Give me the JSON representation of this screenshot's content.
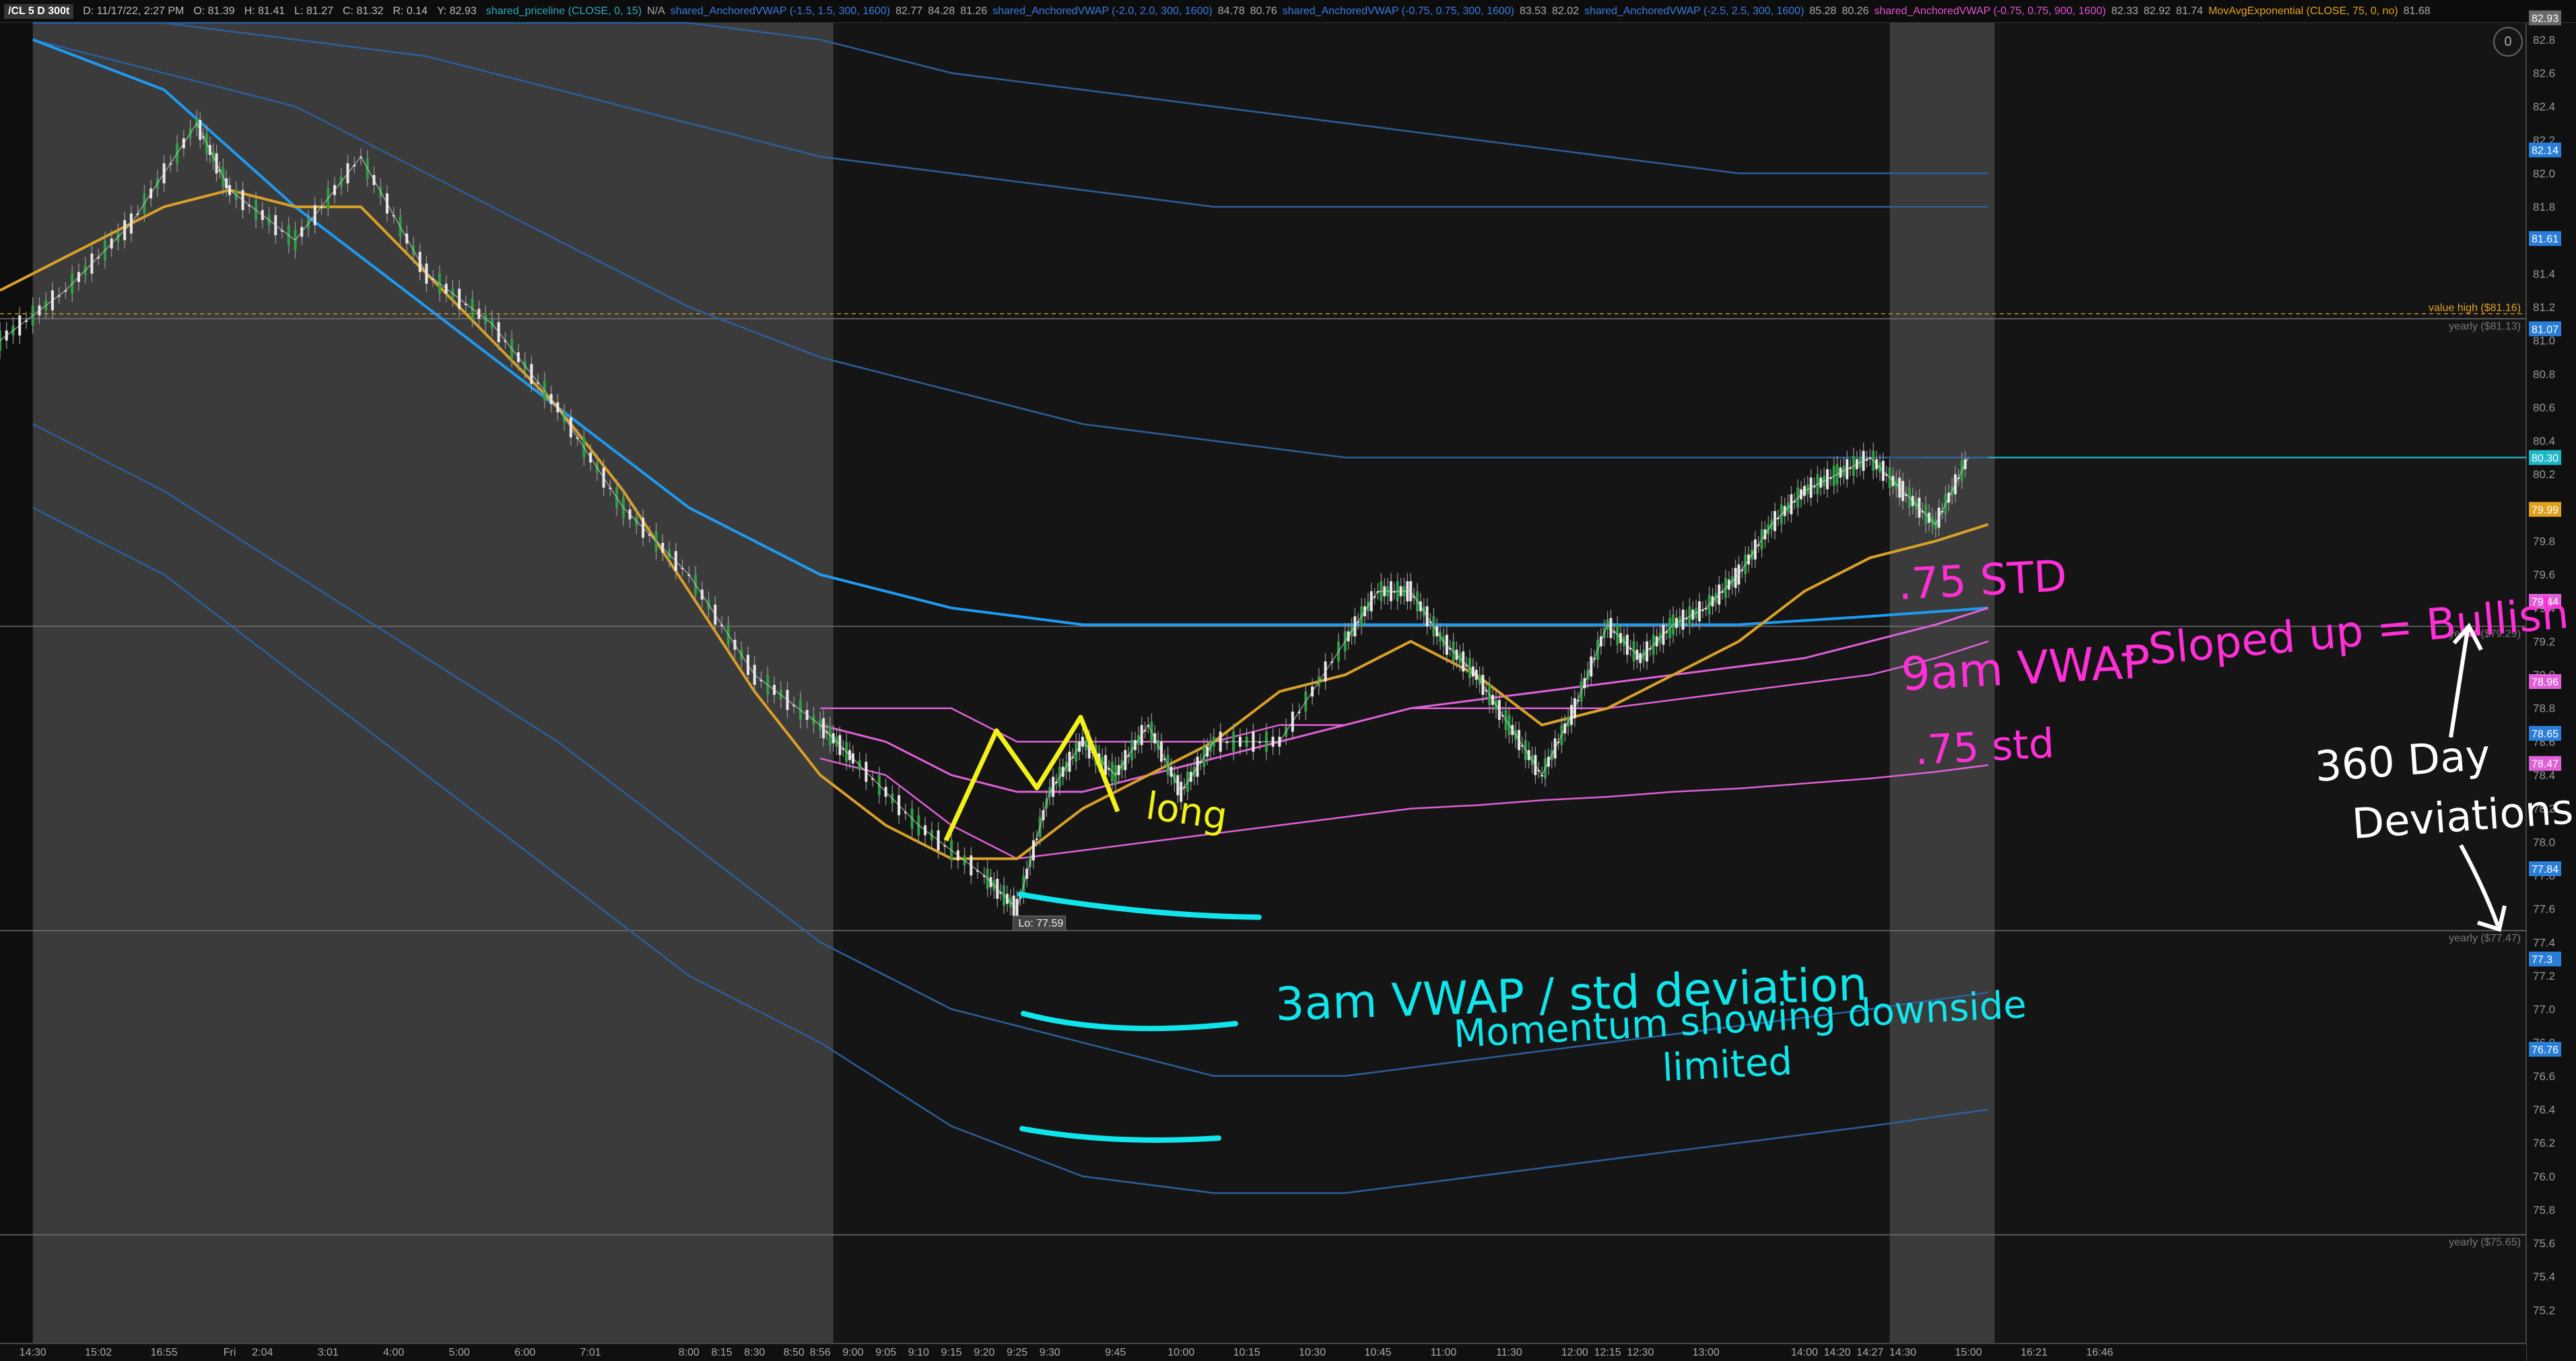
{
  "header": {
    "symbol": "/CL 5 D 300t",
    "date": "D: 11/17/22, 2:27 PM",
    "open": "O: 81.39",
    "high": "H: 81.41",
    "low": "L: 81.27",
    "close": "C: 81.32",
    "range": "R: 0.14",
    "last": "Y: 82.93",
    "studies": [
      {
        "label": "shared_priceline (CLOSE, 0, 15)",
        "values": [
          "N/A"
        ],
        "color": "#2aa8b8"
      },
      {
        "label": "shared_AnchoredVWAP (-1.5, 1.5, 300, 1600)",
        "values": [
          "82.77",
          "84.28",
          "81.26"
        ],
        "color": "#3a7be0"
      },
      {
        "label": "shared_AnchoredVWAP (-2.0, 2.0, 300, 1600)",
        "values": [
          "84.78",
          "80.76"
        ],
        "color": "#3a7be0"
      },
      {
        "label": "shared_AnchoredVWAP (-0.75, 0.75, 300, 1600)",
        "values": [
          "83.53",
          "82.02"
        ],
        "color": "#3a7be0"
      },
      {
        "label": "shared_AnchoredVWAP (-2.5, 2.5, 300, 1600)",
        "values": [
          "85.28",
          "80.26"
        ],
        "color": "#3a7be0"
      },
      {
        "label": "shared_AnchoredVWAP (-0.75, 0.75, 900, 1600)",
        "values": [
          "82.33",
          "82.92",
          "81.74"
        ],
        "color": "#e050d0"
      },
      {
        "label": "MovAvgExponential (CLOSE, 75, 0, no)",
        "values": [
          "81.68"
        ],
        "color": "#e0a020"
      }
    ],
    "settings_label": "0"
  },
  "colors": {
    "background": "#151515",
    "session_shade": "#3b3b3b",
    "ema": "#d9a027",
    "vwap_main": "#1e9af0",
    "vwap_band": "#2c5f9a",
    "vwap_pink": "#e060d8",
    "anno_magenta": "#ff2fd8",
    "anno_cyan": "#10e5ec",
    "anno_yellow": "#f2f21a",
    "anno_white": "#ffffff"
  },
  "chart_data": {
    "type": "line",
    "title": "",
    "xlabel": "",
    "ylabel": "",
    "ylim": [
      75.0,
      82.9
    ],
    "y_ticks": [
      75.2,
      75.4,
      75.6,
      75.8,
      76.0,
      76.2,
      76.4,
      76.6,
      76.8,
      77.0,
      77.2,
      77.4,
      77.6,
      77.8,
      78.0,
      78.2,
      78.4,
      78.6,
      78.8,
      79.0,
      79.2,
      79.4,
      79.6,
      79.8,
      80.0,
      80.2,
      80.4,
      80.6,
      80.8,
      81.0,
      81.2,
      81.4,
      81.6,
      81.8,
      82.0,
      82.2,
      82.4,
      82.6,
      82.8
    ],
    "x_ticks": [
      "14:30",
      "15:02",
      "16:55",
      "Fri",
      "2:04",
      "3:01",
      "4:00",
      "5:00",
      "6:00",
      "7:01",
      "8:00",
      "8:15",
      "8:30",
      "8:50",
      "8:56",
      "9:00",
      "9:05",
      "9:10",
      "9:15",
      "9:20",
      "9:25",
      "9:30",
      "9:45",
      "10:00",
      "10:15",
      "10:30",
      "10:45",
      "11:00",
      "11:30",
      "12:00",
      "12:15",
      "12:30",
      "13:00",
      "14:00",
      "14:20",
      "14:27",
      "14:30",
      "15:00",
      "16:21",
      "16:46"
    ],
    "x_tick_positions": [
      0.0,
      1.0,
      2.0,
      3.0,
      3.5,
      4.5,
      5.5,
      6.5,
      7.5,
      8.5,
      10.0,
      10.5,
      11.0,
      11.6,
      12.0,
      12.5,
      13.0,
      13.5,
      14.0,
      14.5,
      15.0,
      15.5,
      16.5,
      17.5,
      18.5,
      19.5,
      20.5,
      21.5,
      22.5,
      23.5,
      24.0,
      24.5,
      25.5,
      27.0,
      27.5,
      28.0,
      28.5,
      29.5,
      30.5,
      31.5
    ],
    "x_domain": [
      -0.5,
      38.0
    ],
    "shaded_sessions": [
      [
        0.0,
        12.2
      ],
      [
        28.3,
        29.9
      ]
    ],
    "price": {
      "name": "",
      "x": [
        -0.5,
        0.5,
        1.5,
        2.5,
        3.0,
        4.0,
        5.0,
        6.0,
        7.0,
        8.0,
        9.0,
        10.0,
        11.0,
        12.0,
        12.5,
        13.5,
        14.5,
        15.0,
        15.5,
        16.0,
        16.5,
        17.0,
        17.5,
        18.0,
        19.0,
        20.0,
        20.5,
        21.0,
        21.5,
        22.0,
        22.5,
        23.0,
        23.5,
        24.0,
        24.5,
        25.0,
        25.5,
        26.0,
        26.5,
        27.0,
        27.5,
        28.0,
        28.5,
        29.0,
        29.5
      ],
      "values": [
        81.0,
        81.3,
        81.7,
        82.3,
        81.9,
        81.6,
        82.1,
        81.4,
        81.1,
        80.6,
        80.0,
        79.6,
        79.0,
        78.7,
        78.5,
        78.1,
        77.8,
        77.6,
        78.3,
        78.6,
        78.4,
        78.7,
        78.3,
        78.6,
        78.6,
        79.2,
        79.5,
        79.5,
        79.2,
        79.0,
        78.7,
        78.4,
        78.8,
        79.3,
        79.1,
        79.3,
        79.4,
        79.6,
        79.9,
        80.1,
        80.2,
        80.3,
        80.1,
        79.9,
        80.3
      ]
    },
    "ema": {
      "name": "",
      "x": [
        -0.5,
        1.0,
        2.0,
        3.0,
        4.0,
        5.0,
        6.0,
        7.0,
        8.0,
        9.0,
        10.0,
        11.0,
        12.0,
        13.0,
        14.0,
        15.0,
        16.0,
        17.0,
        18.0,
        19.0,
        20.0,
        21.0,
        22.0,
        23.0,
        24.0,
        25.0,
        26.0,
        27.0,
        28.0,
        29.0,
        29.8
      ],
      "values": [
        81.3,
        81.6,
        81.8,
        81.9,
        81.8,
        81.8,
        81.4,
        81.0,
        80.6,
        80.1,
        79.5,
        78.9,
        78.4,
        78.1,
        77.9,
        77.9,
        78.2,
        78.4,
        78.6,
        78.9,
        79.0,
        79.2,
        79.0,
        78.7,
        78.8,
        79.0,
        79.2,
        79.5,
        79.7,
        79.8,
        79.9
      ]
    },
    "vwap_300": {
      "name": "",
      "x": [
        0.0,
        2.0,
        4.0,
        6.0,
        8.0,
        10.0,
        12.0,
        14.0,
        16.0,
        18.0,
        20.0,
        22.0,
        24.0,
        26.0,
        28.0,
        29.8
      ],
      "values": [
        82.8,
        82.5,
        81.8,
        81.2,
        80.6,
        80.0,
        79.6,
        79.4,
        79.3,
        79.3,
        79.3,
        79.3,
        79.3,
        79.3,
        79.35,
        79.4
      ],
      "bands_upper": [
        [
          82.9,
          82.9,
          82.8,
          82.7,
          82.5,
          82.3,
          82.1,
          82.0,
          81.9,
          81.8,
          81.8,
          81.8,
          81.8,
          81.8,
          81.8,
          81.8
        ],
        [
          82.9,
          82.9,
          82.9,
          82.9,
          82.9,
          82.9,
          82.8,
          82.6,
          82.5,
          82.4,
          82.3,
          82.2,
          82.1,
          82.0,
          82.0,
          82.0
        ],
        [
          82.8,
          82.6,
          82.4,
          82.0,
          81.6,
          81.2,
          80.9,
          80.7,
          80.5,
          80.4,
          80.3,
          80.3,
          80.3,
          80.3,
          80.3,
          80.3
        ]
      ],
      "bands_lower": [
        [
          80.5,
          80.1,
          79.6,
          79.1,
          78.6,
          78.0,
          77.4,
          77.0,
          76.8,
          76.6,
          76.6,
          76.7,
          76.8,
          76.9,
          77.0,
          77.1
        ],
        [
          80.0,
          79.6,
          79.0,
          78.4,
          77.8,
          77.2,
          76.8,
          76.3,
          76.0,
          75.9,
          75.9,
          76.0,
          76.1,
          76.2,
          76.3,
          76.4
        ]
      ]
    },
    "vwap_900": {
      "name": "",
      "x": [
        12.0,
        13.0,
        14.0,
        15.0,
        16.0,
        17.0,
        18.0,
        19.0,
        20.0,
        21.0,
        22.0,
        23.0,
        24.0,
        25.0,
        26.0,
        27.0,
        28.0,
        29.0,
        29.8
      ],
      "values": [
        78.7,
        78.6,
        78.4,
        78.3,
        78.3,
        78.4,
        78.5,
        78.6,
        78.7,
        78.8,
        78.85,
        78.9,
        78.95,
        79.0,
        79.05,
        79.1,
        79.2,
        79.3,
        79.4
      ],
      "band_upper": [
        78.8,
        78.8,
        78.8,
        78.6,
        78.6,
        78.6,
        78.6,
        78.7,
        78.7,
        78.8,
        78.8,
        78.8,
        78.8,
        78.85,
        78.9,
        78.95,
        79.0,
        79.1,
        79.2
      ],
      "band_lower": [
        78.5,
        78.4,
        78.1,
        77.9,
        77.95,
        78.0,
        78.05,
        78.1,
        78.15,
        78.2,
        78.22,
        78.25,
        78.27,
        78.3,
        78.32,
        78.35,
        78.38,
        78.42,
        78.46
      ]
    },
    "horizontal_levels": [
      {
        "label": "value high ($81.16)",
        "value": 81.16,
        "color": "#e0a020",
        "dashed": true
      },
      {
        "label": "yearly ($81.13)",
        "value": 81.13,
        "color": "#777777",
        "dashed": false
      },
      {
        "label": "yearly ($79.29)",
        "value": 79.29,
        "color": "#777777",
        "dashed": false
      },
      {
        "label": "yearly ($77.47)",
        "value": 77.47,
        "color": "#777777",
        "dashed": false
      },
      {
        "label": "yearly ($75.65)",
        "value": 75.65,
        "color": "#777777",
        "dashed": false
      },
      {
        "label": "",
        "value": 80.3,
        "color": "#1fb8c8",
        "dashed": false
      }
    ],
    "price_badges": [
      {
        "label": "82.93",
        "value": 82.93,
        "color": "#6a6a6a"
      },
      {
        "label": "82.14",
        "value": 82.14,
        "color": "#2a7ed8"
      },
      {
        "label": "81.61",
        "value": 81.61,
        "color": "#2a7ed8"
      },
      {
        "label": "81.07",
        "value": 81.07,
        "color": "#2a7ed8"
      },
      {
        "label": "80.30",
        "value": 80.3,
        "color": "#1fb8c8"
      },
      {
        "label": "79.99",
        "value": 79.99,
        "color": "#e0a020"
      },
      {
        "label": "79.44",
        "value": 79.44,
        "color": "#e060d8"
      },
      {
        "label": "78.96",
        "value": 78.96,
        "color": "#e060d8"
      },
      {
        "label": "78.65",
        "value": 78.65,
        "color": "#2a7ed8"
      },
      {
        "label": "78.47",
        "value": 78.47,
        "color": "#e060d8"
      },
      {
        "label": "77.84",
        "value": 77.84,
        "color": "#2a7ed8"
      },
      {
        "label": "77.3",
        "value": 77.3,
        "color": "#2a7ed8"
      },
      {
        "label": "76.76",
        "value": 76.76,
        "color": "#2a7ed8"
      }
    ],
    "low_marker": {
      "label": "Lo: 77.59",
      "x": 15.0,
      "value": 77.59
    }
  },
  "annotations": {
    "std_top": ".75 STD",
    "vwap_9am": "9am VWAP",
    "sloped_up": "- Sloped up = Bullish",
    "std_bottom": ".75 std",
    "long": "long",
    "days_360": "360 Day",
    "deviations": "Deviations",
    "vwap_3am_line1": "3am VWAP / std deviation",
    "vwap_3am_line2": "Momentum showing downside",
    "vwap_3am_line3": "limited"
  }
}
